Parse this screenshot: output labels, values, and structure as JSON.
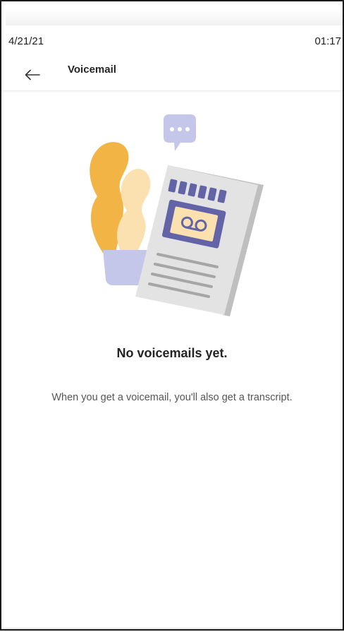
{
  "status_bar": {
    "date": "4/21/21",
    "time": "01:17"
  },
  "header": {
    "title": "Voicemail",
    "back_icon": "arrow-left-icon"
  },
  "empty_state": {
    "illustration": "voicemail-transcript-illustration",
    "title": "No voicemails yet.",
    "description": "When you get a voicemail, you'll also get a transcript."
  },
  "colors": {
    "accent_purple": "#6264a7",
    "light_purple": "#c4c6ea",
    "orange": "#f2b445",
    "light_orange": "#fbe1b0",
    "paper_gray": "#d9d9d9"
  }
}
